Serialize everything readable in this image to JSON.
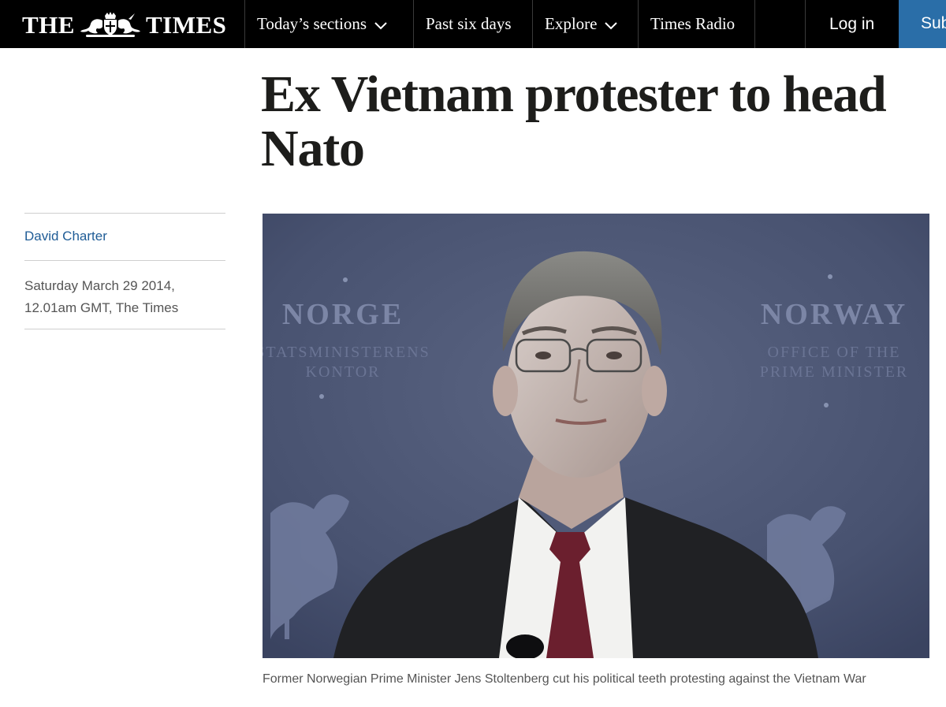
{
  "masthead": {
    "left_word": "THE",
    "right_word": "TIMES",
    "crest_icon": "royal-crest-icon"
  },
  "nav": {
    "items": [
      {
        "label": "Today’s sections",
        "has_dropdown": true
      },
      {
        "label": "Past six days",
        "has_dropdown": false
      },
      {
        "label": "Explore",
        "has_dropdown": true
      },
      {
        "label": "Times Radio",
        "has_dropdown": false
      }
    ],
    "login_label": "Log in",
    "subscribe_label": "Subscribe"
  },
  "article": {
    "headline": "Ex Vietnam protester to head Nato",
    "author": "David Charter",
    "dateline": "Saturday March 29 2014, 12.01am GMT, The Times",
    "image": {
      "left_backdrop_title": "NORGE",
      "left_backdrop_subtitle_1": "STATSMINISTERENS",
      "left_backdrop_subtitle_2": "KONTOR",
      "right_backdrop_title": "NORWAY",
      "right_backdrop_subtitle_1": "OFFICE OF THE",
      "right_backdrop_subtitle_2": "PRIME MINISTER"
    },
    "caption": "Former Norwegian Prime Minister Jens Stoltenberg cut his political teeth protesting against the Vietnam War"
  },
  "colors": {
    "topbar": "#000000",
    "subscribe": "#2a6ea8",
    "author_link": "#1f5c96",
    "backdrop": "#4b5575"
  }
}
